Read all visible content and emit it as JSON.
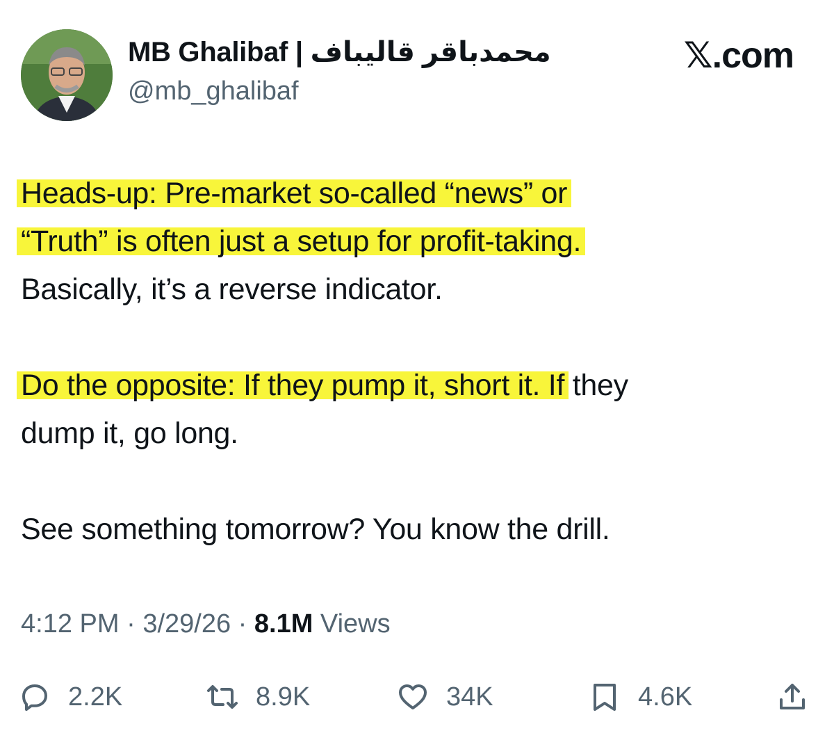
{
  "header": {
    "display_name": "MB Ghalibaf | محمدباقر قالیباف",
    "handle": "@mb_ghalibaf",
    "brand": "𝕏.com",
    "avatar_icon": "profile-photo"
  },
  "tweet": {
    "line1": "Heads-up: Pre-market so-called “news” or",
    "line2": "“Truth” is often just a setup for profit-taking.",
    "line3": "Basically, it’s a reverse indicator.",
    "line4_highlighted": "Do the opposite: If they pump it, short it. If",
    "line4_rest": " they",
    "line5": "dump it, go long.",
    "line6": "See something tomorrow? You know the drill.",
    "highlight_color": "#f8f53a"
  },
  "meta": {
    "time": "4:12 PM",
    "sep1": " · ",
    "date": "3/29/26",
    "sep2": " · ",
    "views_count": "8.1M",
    "views_label": " Views"
  },
  "actions": {
    "reply": {
      "icon": "reply-icon",
      "count": "2.2K"
    },
    "repost": {
      "icon": "repost-icon",
      "count": "8.9K"
    },
    "like": {
      "icon": "heart-icon",
      "count": "34K"
    },
    "bookmark": {
      "icon": "bookmark-icon",
      "count": "4.6K"
    },
    "share": {
      "icon": "share-icon"
    }
  }
}
